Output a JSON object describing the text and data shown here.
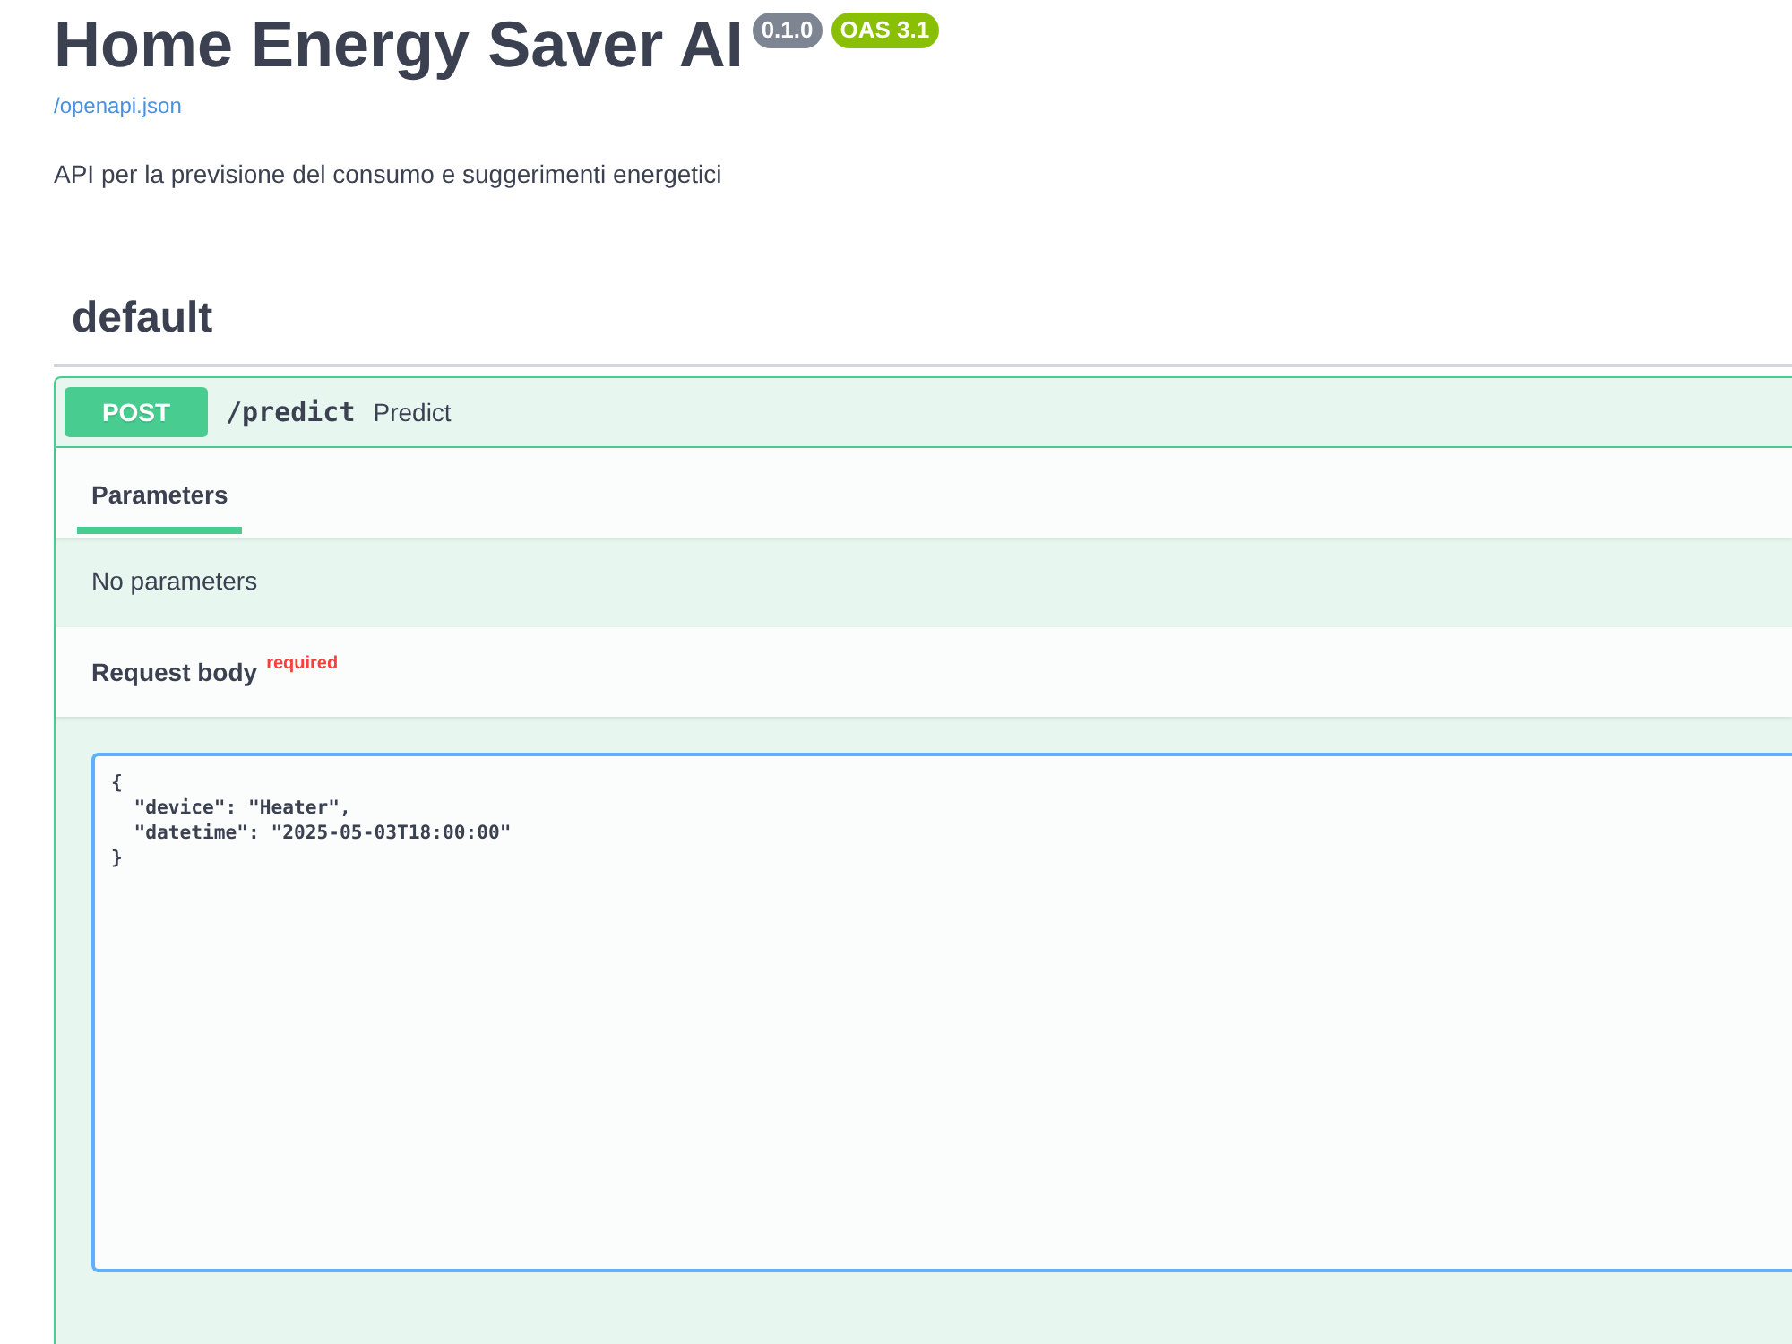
{
  "info": {
    "title": "Home Energy Saver AI",
    "badges": [
      {
        "label": "0.1.0",
        "color": "#7d8492"
      },
      {
        "label": "OAS 3.1",
        "color": "#89bf04"
      }
    ],
    "spec_link": "/openapi.json",
    "description": "API per la previsione del consumo e suggerimenti energetici"
  },
  "sections": [
    {
      "name": "default",
      "operations": [
        {
          "method": "POST",
          "path": "/predict",
          "summary": "Predict",
          "expanded": true,
          "tabs": [
            {
              "label": "Parameters",
              "selected": true
            }
          ],
          "parameters_message": "No parameters",
          "request_body": {
            "label": "Request body",
            "required": true,
            "required_label": "required",
            "value": "{\n  \"device\": \"Heater\",\n  \"datetime\": \"2025-05-03T18:00:00\"\n}"
          }
        }
      ]
    }
  ]
}
